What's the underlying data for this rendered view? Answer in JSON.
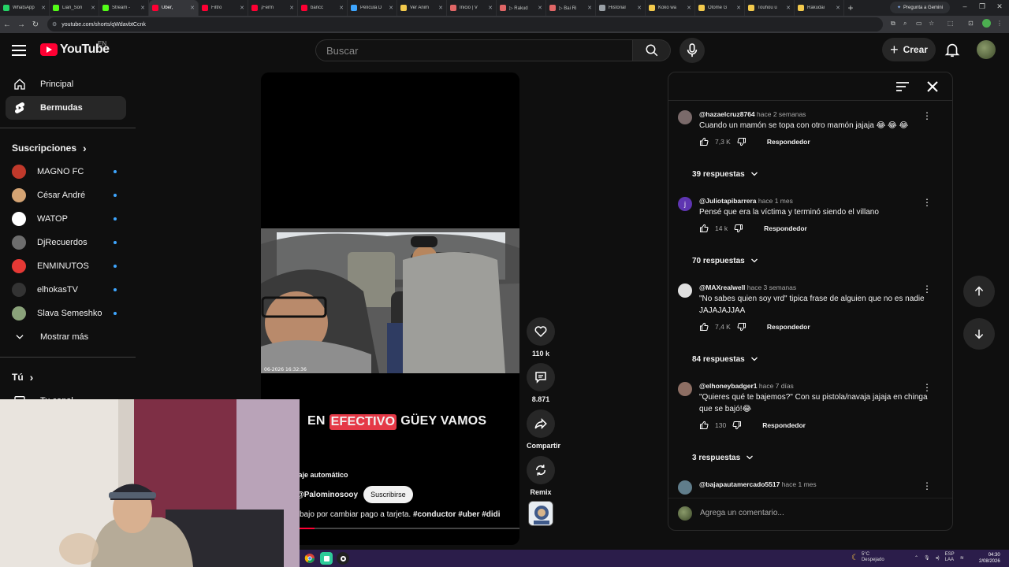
{
  "browser": {
    "tabs": [
      {
        "label": "WhatsApp",
        "color": "#25d366"
      },
      {
        "label": "Lian_Sori",
        "color": "#53fc18"
      },
      {
        "label": "Stream - ",
        "color": "#53fc18"
      },
      {
        "label": "Uber, ",
        "color": "#ff0033",
        "active": true
      },
      {
        "label": "Filtro",
        "color": "#ff0033"
      },
      {
        "label": "¡Ferm",
        "color": "#ff0033"
      },
      {
        "label": "bancc",
        "color": "#ff0033"
      },
      {
        "label": "Película D",
        "color": "#3ea6ff"
      },
      {
        "label": "Ver Anim",
        "color": "#f2c94c"
      },
      {
        "label": "Inicio | V",
        "color": "#e06666"
      },
      {
        "label": "▷ Rakud",
        "color": "#e06666"
      },
      {
        "label": "▷ Bai Ri",
        "color": "#e06666"
      },
      {
        "label": "Historial",
        "color": "#9aa0a6"
      },
      {
        "label": "Koko wa",
        "color": "#f2c94c"
      },
      {
        "label": "Otome G",
        "color": "#f2c94c"
      },
      {
        "label": "Touhou u",
        "color": "#f2c94c"
      },
      {
        "label": "Rakudai",
        "color": "#f2c94c"
      }
    ],
    "gemini_label": "Pregunta a Gemini",
    "url": "youtube.com/shorts/qWdavbtCcnk"
  },
  "masthead": {
    "logo_text": "YouTube",
    "region": "EN",
    "search_placeholder": "Buscar",
    "create_label": "Crear"
  },
  "sidebar": {
    "main": [
      {
        "label": "Principal",
        "icon": "home-icon"
      },
      {
        "label": "Bermudas",
        "icon": "shorts-icon",
        "active": true
      }
    ],
    "subscriptions_title": "Suscripciones",
    "subscriptions": [
      {
        "label": "MAGNO FC",
        "color": "#c0392b"
      },
      {
        "label": "César André",
        "color": "#d4a373"
      },
      {
        "label": "WATOP",
        "color": "#ffffff"
      },
      {
        "label": "DjRecuerdos",
        "color": "#6d6d6d"
      },
      {
        "label": "ENMINUTOS",
        "color": "#e53935"
      },
      {
        "label": "elhokasTV",
        "color": "#333333"
      },
      {
        "label": "Slava Semeshko",
        "color": "#8aa27a"
      }
    ],
    "show_more": "Mostrar más",
    "you_title": "Tú",
    "your_channel": "Tu canal"
  },
  "short": {
    "caption_pre": "EN",
    "caption_highlight": "EFECTIVO",
    "caption_post": "GÜEY VAMOS",
    "overlay_timestamp": "06-2026  16:32:36",
    "autodub": "laje automático",
    "channel": "@Palominosooy",
    "subscribe": "Suscribirse",
    "description": "bajo por cambiar pago a tarjeta.",
    "hashtags": "#conductor #uber #didi",
    "progress": 0.08,
    "likes": "110 k",
    "comments_count": "8.871",
    "share_label": "Compartir",
    "remix_label": "Remix"
  },
  "comments_panel": {
    "comments": [
      {
        "author": "@hazaelcruz8764",
        "time": "hace 2 semanas",
        "text": "Cuando un mamón se topa con otro mamón jajaja 😂 😂 😂",
        "likes": "7,3 K",
        "reply": "Respondedor",
        "replies": "39 respuestas",
        "avatar_color": "#7a6a6a"
      },
      {
        "author": "@Juliotapibarrera",
        "time": "hace 1 mes",
        "text": "Pensé que era la víctima y terminó siendo el villano",
        "likes": "14 k",
        "reply": "Respondedor",
        "replies": "70 respuestas",
        "avatar_color": "#5e35b1",
        "initial": "j"
      },
      {
        "author": "@MAXrealwell",
        "time": "hace 3 semanas",
        "text": "\"No sabes quien soy vrd\" tipica frase de alguien que no es nadie JAJAJAJJAA",
        "likes": "7,4 K",
        "reply": "Respondedor",
        "replies": "84 respuestas",
        "avatar_color": "#e0e0e0"
      },
      {
        "author": "@elhoneybadger1",
        "time": "hace 7 días",
        "text": "\"Quieres qué te bajemos?\" Con su pistola/navaja jajaja en chinga que se bajó!😂",
        "likes": "130",
        "reply": "Respondedor",
        "replies": "3 respuestas",
        "avatar_color": "#8d6e63"
      },
      {
        "author": "@bajapautamercado5517",
        "time": "hace 1 mes",
        "text": "",
        "likes": "",
        "reply": "",
        "replies": "",
        "avatar_color": "#607d8b"
      }
    ],
    "add_placeholder": "Agrega un comentario..."
  },
  "taskbar": {
    "temp": "5°C",
    "weather": "Despejado",
    "lang_top": "ESP",
    "lang_bottom": "LAA",
    "time": "04:30",
    "date": "2/08/2026"
  }
}
